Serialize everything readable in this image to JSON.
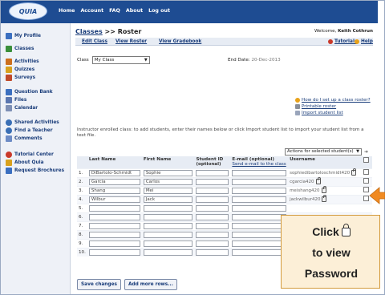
{
  "header": {
    "logo_text": "QUIA",
    "nav": [
      "Home",
      "Account",
      "FAQ",
      "About",
      "Log out"
    ]
  },
  "sidebar": {
    "items": [
      {
        "label": "My Profile",
        "icon": "profile-icon",
        "color": "#3b6fc0"
      },
      {
        "label": "Classes",
        "icon": "classes-icon",
        "color": "#3a8f3a"
      },
      {
        "label": "Activities",
        "icon": "activities-icon",
        "color": "#cc6f1e"
      },
      {
        "label": "Quizzes",
        "icon": "quizzes-icon",
        "color": "#d8a11e"
      },
      {
        "label": "Surveys",
        "icon": "surveys-icon",
        "color": "#c04a2b"
      },
      {
        "label": "Question Bank",
        "icon": "question-bank-icon",
        "color": "#3b6fc0"
      },
      {
        "label": "Files",
        "icon": "files-icon",
        "color": "#5a76b0"
      },
      {
        "label": "Calendar",
        "icon": "calendar-icon",
        "color": "#7d8fb5"
      },
      {
        "label": "Shared Activities",
        "icon": "shared-icon",
        "color": "#3a6fb5"
      },
      {
        "label": "Find a Teacher",
        "icon": "find-teacher-icon",
        "color": "#3a6fb5"
      },
      {
        "label": "Comments",
        "icon": "comments-icon",
        "color": "#6d8cc6"
      },
      {
        "label": "Tutorial Center",
        "icon": "tutorial-icon",
        "color": "#c93a2b"
      },
      {
        "label": "About Quia",
        "icon": "about-icon",
        "color": "#d8a11e"
      },
      {
        "label": "Request Brochures",
        "icon": "brochure-icon",
        "color": "#3b6fc0"
      }
    ]
  },
  "breadcrumb": {
    "link": "Classes",
    "sep": ">>",
    "current": "Roster"
  },
  "welcome": {
    "prefix": "Welcome,",
    "name": "Keith Cothrun"
  },
  "tabs": [
    "Edit Class",
    "View Roster",
    "View Gradebook"
  ],
  "header_links": {
    "tutorials": "Tutorials",
    "help": "Help"
  },
  "class_select": {
    "label": "Class",
    "value": "My Class"
  },
  "end_date": {
    "label": "End Date:",
    "value": "20-Dec-2013"
  },
  "help": {
    "link1": "How do I set up a class roster?",
    "link2": "Printable roster",
    "link3": "Import student list"
  },
  "instructions": "Instructor enrolled class: to add students, enter their names below or click Import student list to import your student list from a text file.",
  "actions_select": "Actions for selected student(s)",
  "table": {
    "headers": {
      "last": "Last Name",
      "first": "First Name",
      "id": "Student ID (optional)",
      "email": "E-mail (optional)",
      "email_sub": "Send e-mail to the class",
      "username": "Username"
    },
    "rows": [
      {
        "n": "1.",
        "last": "DiBartolo-Schmidt",
        "first": "Sophie",
        "id": "",
        "email": "",
        "user": "sophiedibartoloschmidt420",
        "lock": true
      },
      {
        "n": "2.",
        "last": "Garcia",
        "first": "Carlos",
        "id": "",
        "email": "",
        "user": "cgarcia420",
        "lock": true
      },
      {
        "n": "3.",
        "last": "Shang",
        "first": "Mei",
        "id": "",
        "email": "",
        "user": "meishang420",
        "lock": true
      },
      {
        "n": "4.",
        "last": "Wilbur",
        "first": "Jack",
        "id": "",
        "email": "",
        "user": "jackwilbur420",
        "lock": true
      },
      {
        "n": "5.",
        "last": "",
        "first": "",
        "id": "",
        "email": "",
        "user": "",
        "lock": false
      },
      {
        "n": "6.",
        "last": "",
        "first": "",
        "id": "",
        "email": "",
        "user": "",
        "lock": false
      },
      {
        "n": "7.",
        "last": "",
        "first": "",
        "id": "",
        "email": "",
        "user": "",
        "lock": false
      },
      {
        "n": "8.",
        "last": "",
        "first": "",
        "id": "",
        "email": "",
        "user": "",
        "lock": false
      },
      {
        "n": "9.",
        "last": "",
        "first": "",
        "id": "",
        "email": "",
        "user": "",
        "lock": false
      },
      {
        "n": "10.",
        "last": "",
        "first": "",
        "id": "",
        "email": "",
        "user": "",
        "lock": false
      }
    ]
  },
  "buttons": {
    "save": "Save changes",
    "add": "Add more rows..."
  },
  "callout": {
    "line1": "Click",
    "line2": "to view",
    "line3": "Password"
  }
}
